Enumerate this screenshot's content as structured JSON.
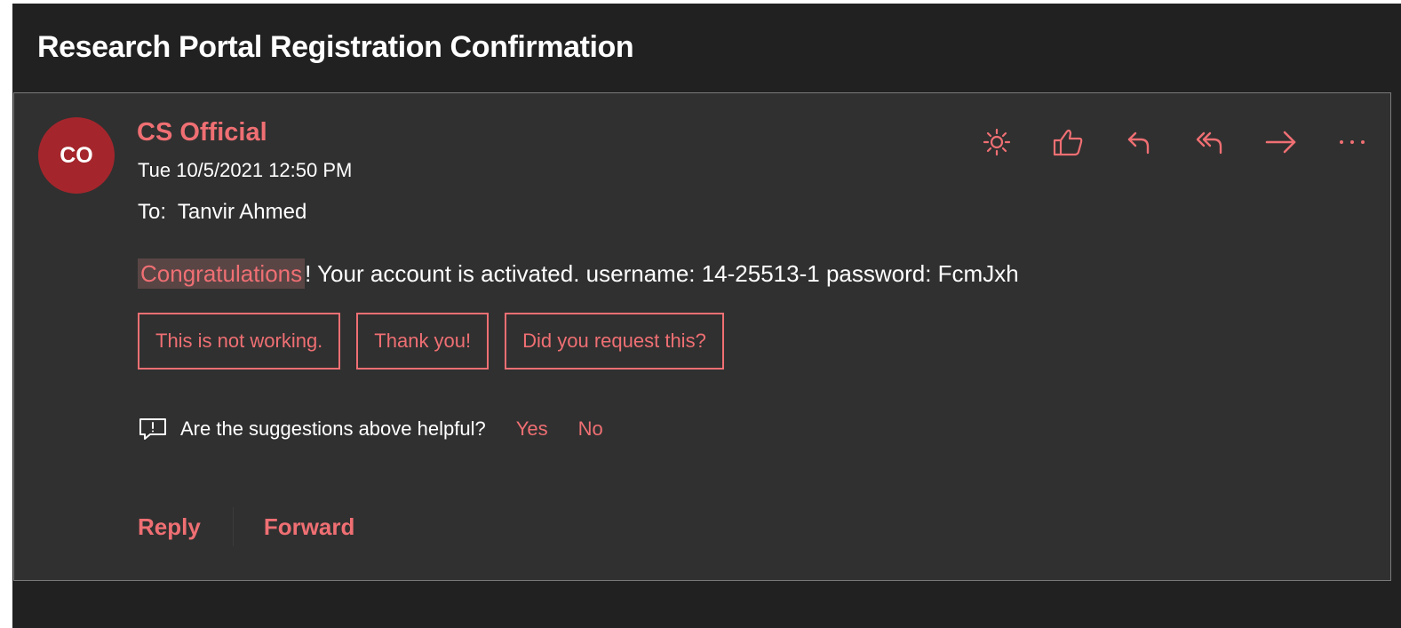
{
  "email": {
    "subject": "Research Portal Registration Confirmation",
    "sender_initials": "CO",
    "sender_name": "CS Official",
    "date": "Tue 10/5/2021 12:50 PM",
    "to_label": "To:",
    "recipient": "Tanvir Ahmed",
    "body": {
      "highlighted": "Congratulations",
      "rest": "! Your account is activated. username: 14-25513-1 password: FcmJxh"
    }
  },
  "actions": [
    {
      "icon": "brightness-icon"
    },
    {
      "icon": "thumbs-up-icon"
    },
    {
      "icon": "reply-icon"
    },
    {
      "icon": "reply-all-icon"
    },
    {
      "icon": "forward-icon"
    },
    {
      "icon": "more-icon"
    }
  ],
  "suggested_replies": [
    "This is not working.",
    "Thank you!",
    "Did you request this?"
  ],
  "feedback": {
    "question": "Are the suggestions above helpful?",
    "yes": "Yes",
    "no": "No"
  },
  "footer": {
    "reply": "Reply",
    "forward": "Forward"
  },
  "colors": {
    "accent": "#ef6f73",
    "avatar": "#a4262c",
    "background": "#212121",
    "card": "#303030"
  }
}
